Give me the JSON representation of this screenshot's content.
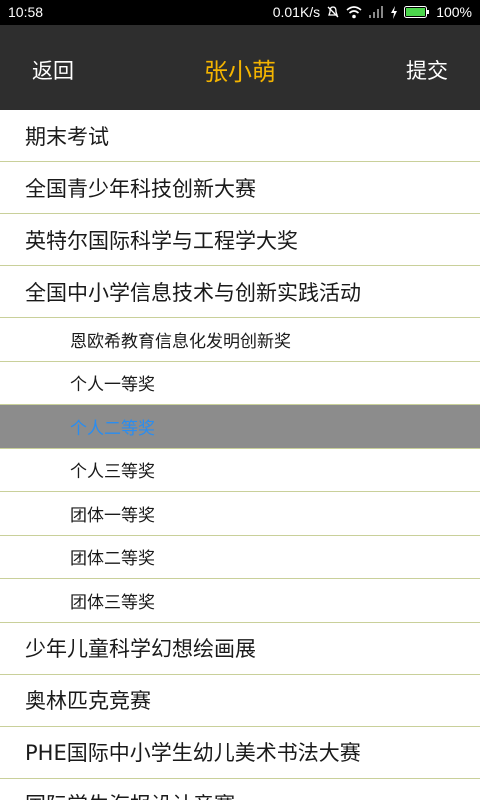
{
  "status_bar": {
    "time": "10:58",
    "speed": "0.01K/s",
    "battery": "100%"
  },
  "header": {
    "back_label": "返回",
    "title": "张小萌",
    "submit_label": "提交"
  },
  "items": [
    {
      "label": "期末考试",
      "level": "main",
      "selected": false
    },
    {
      "label": "全国青少年科技创新大赛",
      "level": "main",
      "selected": false
    },
    {
      "label": "英特尔国际科学与工程学大奖",
      "level": "main",
      "selected": false
    },
    {
      "label": "全国中小学信息技术与创新实践活动",
      "level": "main",
      "selected": false
    },
    {
      "label": "恩欧希教育信息化发明创新奖",
      "level": "sub",
      "selected": false
    },
    {
      "label": "个人一等奖",
      "level": "sub",
      "selected": false
    },
    {
      "label": "个人二等奖",
      "level": "sub",
      "selected": true
    },
    {
      "label": "个人三等奖",
      "level": "sub",
      "selected": false
    },
    {
      "label": "团体一等奖",
      "level": "sub",
      "selected": false
    },
    {
      "label": "团体二等奖",
      "level": "sub",
      "selected": false
    },
    {
      "label": "团体三等奖",
      "level": "sub",
      "selected": false
    },
    {
      "label": "少年儿童科学幻想绘画展",
      "level": "main",
      "selected": false
    },
    {
      "label": "奥林匹克竞赛",
      "level": "main",
      "selected": false
    },
    {
      "label": "PHE国际中小学生幼儿美术书法大赛",
      "level": "main",
      "selected": false
    },
    {
      "label": "国际学生海报设计竞赛",
      "level": "main",
      "selected": false
    }
  ],
  "colors": {
    "title_accent": "#f4b400",
    "selected_bg": "#8c8c8c",
    "selected_text": "#2a8df0",
    "divider": "#c9d09a"
  },
  "icons": [
    "mute-icon",
    "wifi-icon",
    "signal-icon",
    "charging-icon",
    "battery-icon"
  ]
}
